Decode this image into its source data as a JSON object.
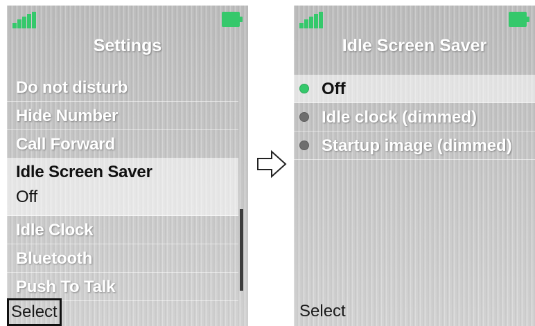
{
  "left_screen": {
    "title": "Settings",
    "menu_items": [
      {
        "label": "Do not disturb"
      },
      {
        "label": "Hide Number"
      },
      {
        "label": "Call Forward"
      }
    ],
    "selected_item": {
      "label": "Idle Screen Saver",
      "value": "Off"
    },
    "menu_items_after": [
      {
        "label": "Idle Clock"
      },
      {
        "label": "Bluetooth"
      },
      {
        "label": "Push To Talk"
      }
    ],
    "softkey": "Select"
  },
  "right_screen": {
    "title": "Idle Screen Saver",
    "options": [
      {
        "label": "Off",
        "selected": true
      },
      {
        "label": "Idle clock (dimmed)",
        "selected": false
      },
      {
        "label": "Startup image (dimmed)",
        "selected": false
      }
    ],
    "softkey": "Select"
  },
  "colors": {
    "accent": "#35c86b",
    "screen_background": "#c2c2c2",
    "unselected_radio": "#6e6e6e",
    "highlight_text": "#111111"
  },
  "icons": {
    "signal": "signal-strength-icon",
    "battery": "battery-icon",
    "transition_arrow": "right-arrow-icon"
  }
}
